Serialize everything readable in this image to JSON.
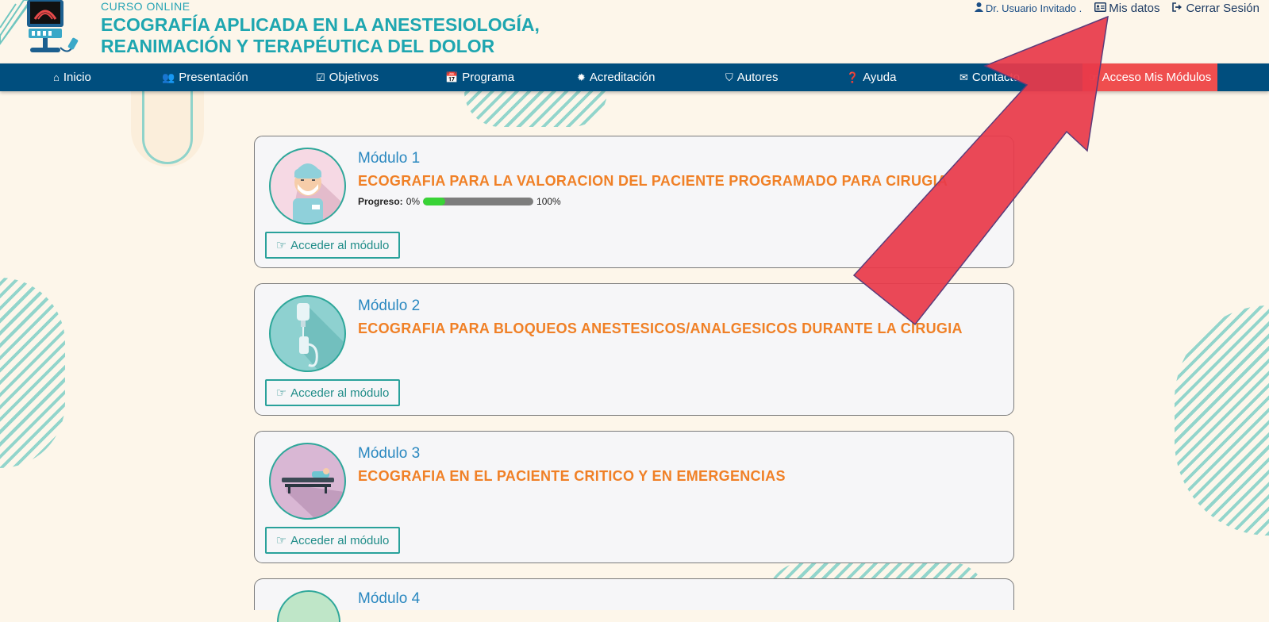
{
  "header": {
    "pre_title": "CURSO ONLINE",
    "title_line1": "ECOGRAFÍA APLICADA EN LA ANESTESIOLOGÍA,",
    "title_line2": "REANIMACIÓN Y TERAPÉUTICA DEL DOLOR",
    "user_name": "Dr. Usuario Invitado .",
    "my_data": "Mis datos",
    "logout": "Cerrar Sesión"
  },
  "nav": [
    {
      "label": "Inicio",
      "icon": "home-icon"
    },
    {
      "label": "Presentación",
      "icon": "users-icon"
    },
    {
      "label": "Objetivos",
      "icon": "check-square-icon"
    },
    {
      "label": "Programa",
      "icon": "calendar-check-icon"
    },
    {
      "label": "Acreditación",
      "icon": "badge-icon"
    },
    {
      "label": "Autores",
      "icon": "shield-icon"
    },
    {
      "label": "Ayuda",
      "icon": "question-icon"
    },
    {
      "label": "Contacto",
      "icon": "envelope-icon"
    },
    {
      "label": "Acceso Mis Módulos",
      "icon": "hand-pointer-icon"
    }
  ],
  "modules": [
    {
      "label": "Módulo 1",
      "title": "ECOGRAFIA PARA LA VALORACION DEL PACIENTE PROGRAMADO PARA CIRUGIA",
      "progress_label": "Progreso:",
      "progress_min": "0%",
      "progress_max": "100%",
      "progress_value": 0.2,
      "button": "Acceder al módulo",
      "avatar_bg": "#f6d9e4"
    },
    {
      "label": "Módulo 2",
      "title": "ECOGRAFIA PARA BLOQUEOS ANESTESICOS/ANALGESICOS DURANTE LA CIRUGIA",
      "button": "Acceder al módulo",
      "avatar_bg": "#8ed1d0"
    },
    {
      "label": "Módulo 3",
      "title": "ECOGRAFIA EN EL PACIENTE CRITICO Y EN EMERGENCIAS",
      "button": "Acceder al módulo",
      "avatar_bg": "#d9b7d4"
    },
    {
      "label": "Módulo 4"
    }
  ],
  "colors": {
    "nav_bg": "#004e7e",
    "cta_bg": "#ef4e4e",
    "title_teal": "#1ea6b0",
    "module_label": "#2a88c0",
    "module_title": "#f08026",
    "progress_fill": "#39d336",
    "arrow": "#e83a4a"
  }
}
